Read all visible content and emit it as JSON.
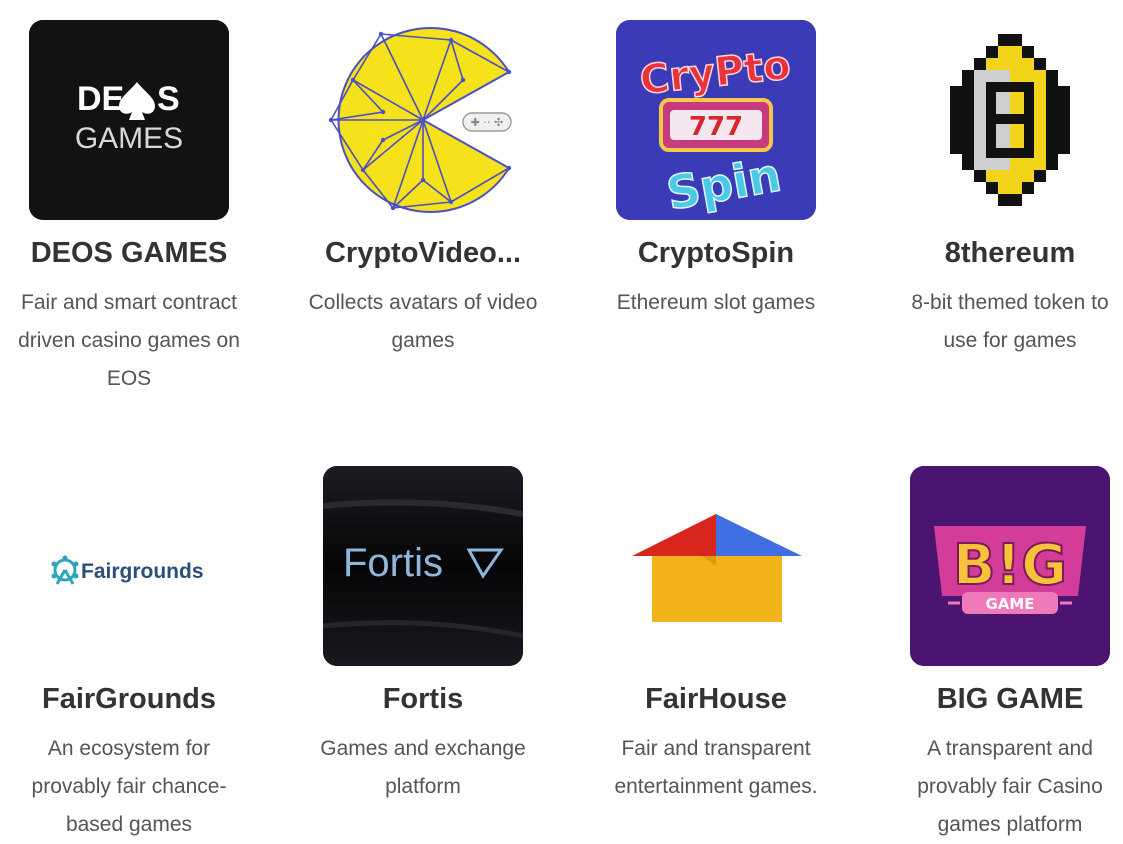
{
  "apps": [
    {
      "name": "DEOS GAMES",
      "description": "Fair and smart contract driven casino games on EOS",
      "logo_icon": "deos-games-logo",
      "logo_text_top": "DE",
      "logo_text_top_end": "S",
      "logo_text_bottom": "GAMES"
    },
    {
      "name": "CryptoVideo...",
      "description": "Collects avatars of video games",
      "logo_icon": "cryptovideogames-pacman-logo"
    },
    {
      "name": "CryptoSpin",
      "description": "Ethereum slot games",
      "logo_icon": "cryptospin-logo",
      "logo_text_top": "CryPto",
      "logo_text_middle": "777",
      "logo_text_bottom": "Spin"
    },
    {
      "name": "8thereum",
      "description": "8-bit themed token to use for games",
      "logo_icon": "8thereum-pixel-logo"
    },
    {
      "name": "FairGrounds",
      "description": "An ecosystem for provably fair chance-based games",
      "logo_icon": "fairgrounds-logo",
      "logo_text": "Fairgrounds"
    },
    {
      "name": "Fortis",
      "description": "Games and exchange platform",
      "logo_icon": "fortis-logo",
      "logo_text": "Fortis"
    },
    {
      "name": "FairHouse",
      "description": "Fair and transparent entertainment games.",
      "logo_icon": "fairhouse-logo"
    },
    {
      "name": "BIG GAME",
      "description": "A transparent and provably fair Casino games platform",
      "logo_icon": "big-game-logo",
      "logo_text_top": "B!G",
      "logo_text_bottom": "GAME"
    }
  ],
  "colors": {
    "title": "#333333",
    "description": "#555555",
    "deos_bg": "#121212",
    "pacman_yellow": "#f5e21a",
    "pacman_lines": "#4a4fc4",
    "cryptospin_bg": "#3b3bb8",
    "eight_yellow": "#f2d41a",
    "fairgrounds_teal": "#2aa6b8",
    "fortis_bg": "#0a0a0c",
    "fortis_text": "#8fb7dc",
    "fairhouse_red": "#d9261c",
    "fairhouse_blue": "#3f6fe0",
    "fairhouse_yellow": "#f2b21a",
    "biggame_bg": "#4a1470"
  }
}
